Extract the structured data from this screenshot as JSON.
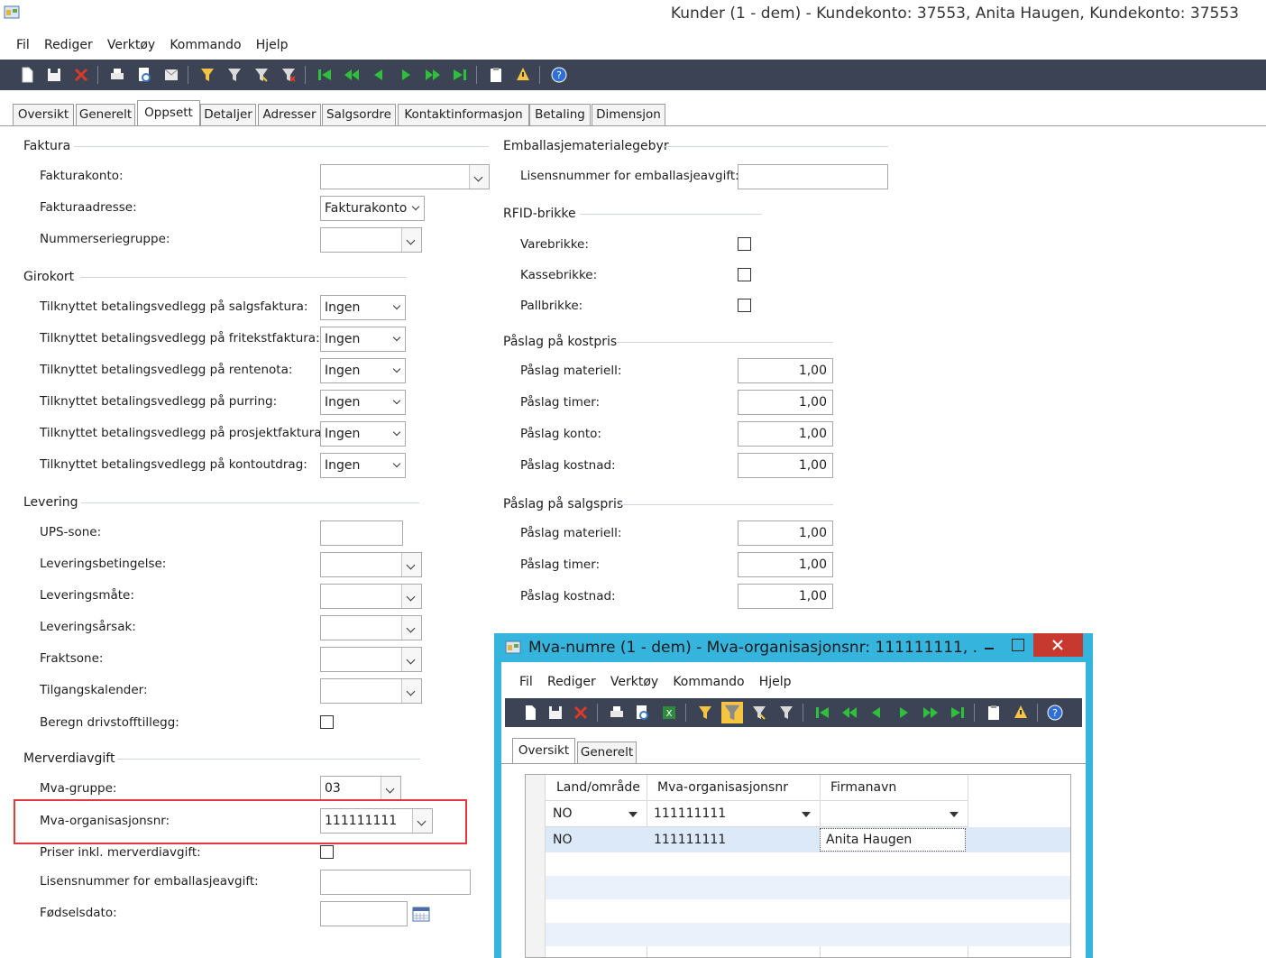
{
  "window": {
    "title": "Kunder (1 - dem) - Kundekonto: 37553, Anita Haugen, Kundekonto: 37553"
  },
  "menu": [
    "Fil",
    "Rediger",
    "Verktøy",
    "Kommando",
    "Hjelp"
  ],
  "tabs": [
    "Oversikt",
    "Generelt",
    "Oppsett",
    "Detaljer",
    "Adresser",
    "Salgsordre",
    "Kontaktinformasjon",
    "Betaling",
    "Dimensjon"
  ],
  "active_tab": "Oppsett",
  "faktura": {
    "title": "Faktura",
    "fakturakonto_label": "Fakturakonto:",
    "fakturakonto_value": "",
    "fakturaadresse_label": "Fakturaadresse:",
    "fakturaadresse_value": "Fakturakonto",
    "nummerseriegruppe_label": "Nummerseriegruppe:",
    "nummerseriegruppe_value": ""
  },
  "girokort": {
    "title": "Girokort",
    "rows": [
      {
        "label": "Tilknyttet betalingsvedlegg på salgsfaktura:",
        "value": "Ingen"
      },
      {
        "label": "Tilknyttet betalingsvedlegg på fritekstfaktura:",
        "value": "Ingen"
      },
      {
        "label": "Tilknyttet betalingsvedlegg på rentenota:",
        "value": "Ingen"
      },
      {
        "label": "Tilknyttet betalingsvedlegg på purring:",
        "value": "Ingen"
      },
      {
        "label": "Tilknyttet betalingsvedlegg på prosjektfaktura:",
        "value": "Ingen"
      },
      {
        "label": "Tilknyttet betalingsvedlegg på kontoutdrag:",
        "value": "Ingen"
      }
    ]
  },
  "levering": {
    "title": "Levering",
    "ups_label": "UPS-sone:",
    "betingelse_label": "Leveringsbetingelse:",
    "maate_label": "Leveringsmåte:",
    "aarsak_label": "Leveringsårsak:",
    "fraktsone_label": "Fraktsone:",
    "kalender_label": "Tilgangskalender:",
    "drivstoff_label": "Beregn drivstofftillegg:",
    "drivstoff_checked": false
  },
  "merverdiavgift": {
    "title": "Merverdiavgift",
    "mva_gruppe_label": "Mva-gruppe:",
    "mva_gruppe_value": "03",
    "mva_org_label": "Mva-organisasjonsnr:",
    "mva_org_value": "111111111",
    "priser_label": "Priser inkl. merverdiavgift:",
    "priser_checked": false,
    "lisens_label": "Lisensnummer for emballasjeavgift:",
    "lisens_value": "",
    "fodsel_label": "Fødselsdato:",
    "fodsel_value": ""
  },
  "emballasje": {
    "title": "Emballasjematerialegebyr",
    "lisens_label": "Lisensnummer for emballasjeavgift:",
    "lisens_value": ""
  },
  "rfid": {
    "title": "RFID-brikke",
    "rows": [
      {
        "label": "Varebrikke:",
        "checked": false
      },
      {
        "label": "Kassebrikke:",
        "checked": false
      },
      {
        "label": "Pallbrikke:",
        "checked": false
      }
    ]
  },
  "kostpris": {
    "title": "Påslag på kostpris",
    "rows": [
      {
        "label": "Påslag materiell:",
        "value": "1,00"
      },
      {
        "label": "Påslag timer:",
        "value": "1,00"
      },
      {
        "label": "Påslag konto:",
        "value": "1,00"
      },
      {
        "label": "Påslag kostnad:",
        "value": "1,00"
      }
    ]
  },
  "salgspris": {
    "title": "Påslag på salgspris",
    "rows": [
      {
        "label": "Påslag materiell:",
        "value": "1,00"
      },
      {
        "label": "Påslag timer:",
        "value": "1,00"
      },
      {
        "label": "Påslag kostnad:",
        "value": "1,00"
      }
    ]
  },
  "child": {
    "title": "Mva-numre (1 - dem) - Mva-organisasjonsnr: 111111111, ...",
    "menu": [
      "Fil",
      "Rediger",
      "Verktøy",
      "Kommando",
      "Hjelp"
    ],
    "tabs": [
      "Oversikt",
      "Generelt"
    ],
    "active_tab": "Oversikt",
    "columns": [
      "Land/område",
      "Mva-organisasjonsnr",
      "Firmanavn"
    ],
    "filter": {
      "land": "NO",
      "org": "111111111",
      "firma": ""
    },
    "rows": [
      {
        "land": "NO",
        "org": "111111111",
        "firma": "Anita Haugen"
      }
    ]
  },
  "colors": {
    "toolbar": "#3b4354",
    "highlight": "#e0393e",
    "child_frame": "#35b5dd",
    "close_button": "#c7392f"
  }
}
